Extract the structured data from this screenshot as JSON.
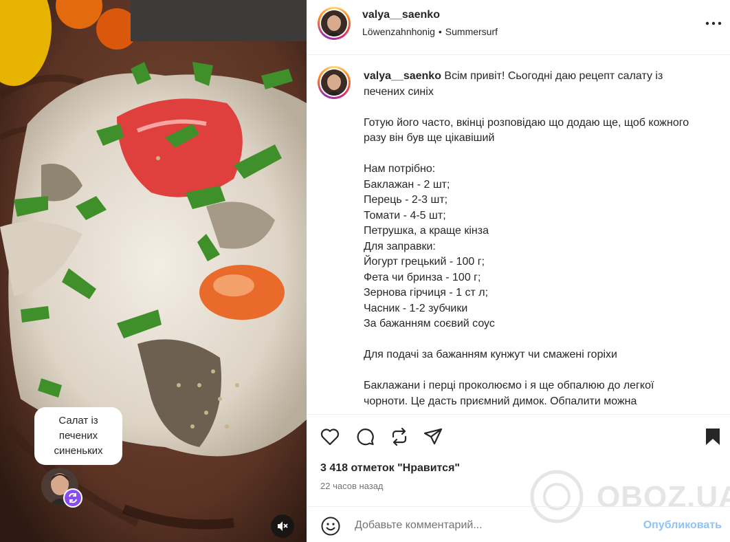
{
  "media": {
    "bubble_text": "Салат із печених синеньких",
    "icons": {
      "reel_badge": "remix-icon",
      "mute": "speaker-muted-icon"
    }
  },
  "header": {
    "username": "valya__saenko",
    "music": "Löwenzahnhonig",
    "separator": "•",
    "audio": "Summersurf",
    "more_icon": "more-horizontal-icon"
  },
  "caption": {
    "username": "valya__saenko",
    "text": " Всім привіт! Сьогодні даю рецепт салату із печених синіх\n\nГотую його часто, вкінці розповідаю що додаю ще, щоб кожного разу він був ще цікавіший\n\nНам потрібно:\nБаклажан - 2 шт;\nПерець - 2-3 шт;\nТомати - 4-5 шт;\nПетрушка, а краще кінза\nДля заправки:\nЙогурт грецький - 100 г;\nФета чи бринза - 100 г;\nЗернова гірчиця - 1 ст л;\nЧасник - 1-2 зубчики\nЗа бажанням соєвий соус\n\nДля подачі за бажанням кунжут чи смажені горіхи\n\nБаклажани і перці проколюємо і я ще обпалюю до легкої чорноти. Це дасть приємний димок. Обпалити можна"
  },
  "actions": {
    "icons": [
      "heart-icon",
      "comment-icon",
      "repost-icon",
      "share-icon",
      "bookmark-icon"
    ],
    "likes": "3 418 отметок \"Нравится\"",
    "time": "22 часов назад"
  },
  "comment": {
    "placeholder": "Добавьте комментарий...",
    "post_label": "Опубликовать"
  },
  "watermark": {
    "text": "OBOZ.UA"
  },
  "colors": {
    "post_button": "#8fc2f7",
    "badge": "#8a4cf0",
    "secondary_text": "#737373"
  }
}
